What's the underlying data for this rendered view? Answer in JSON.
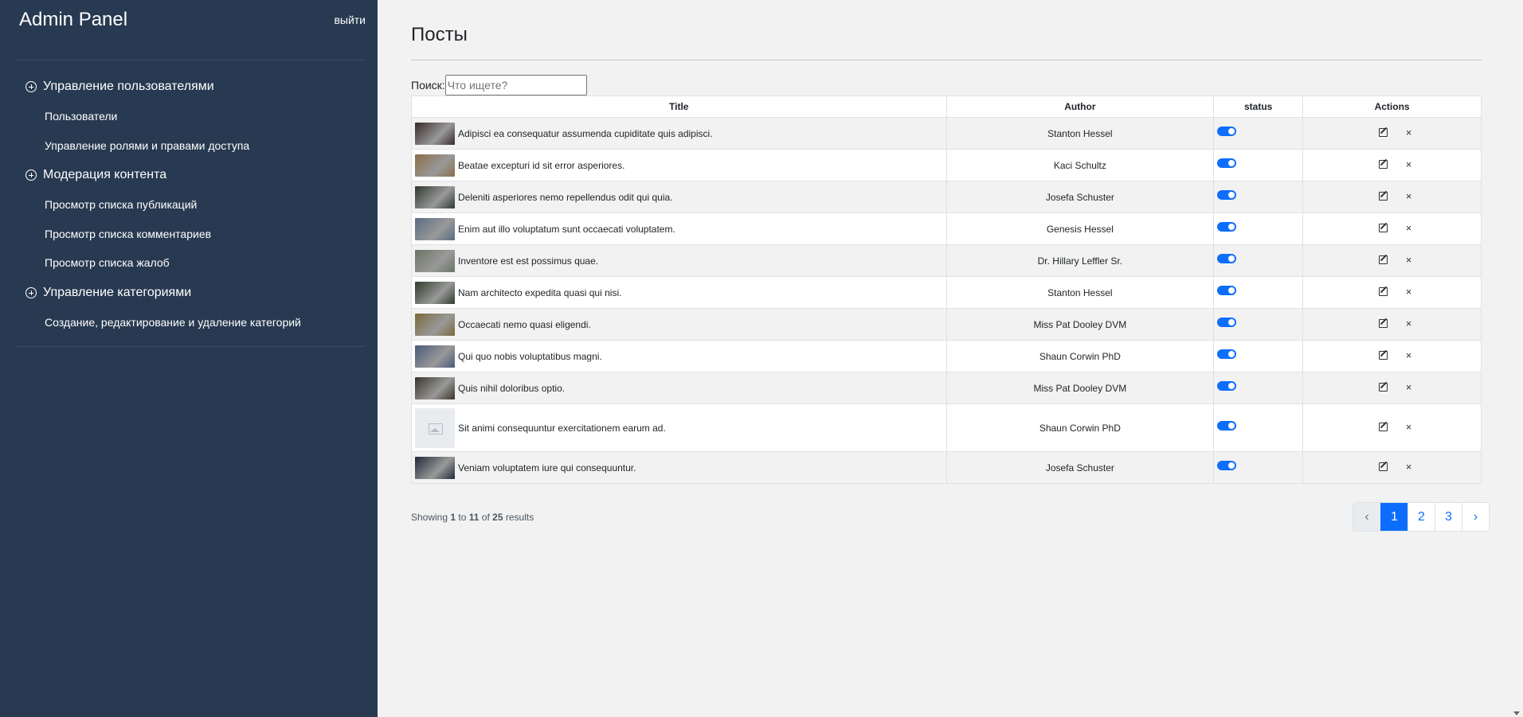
{
  "sidebar": {
    "title": "Admin Panel",
    "logout": "выйти",
    "groups": [
      {
        "label": "Управление пользователями",
        "items": [
          "Пользователи",
          "Управление ролями и правами доступа"
        ]
      },
      {
        "label": "Модерация контента",
        "items": [
          "Просмотр списка публикаций",
          "Просмотр списка комментариев",
          "Просмотр списка жалоб"
        ]
      },
      {
        "label": "Управление категориями",
        "items": [
          "Создание, редактирование и удаление категорий"
        ]
      }
    ]
  },
  "main": {
    "page_title": "Посты",
    "search": {
      "label": "Поиск:",
      "placeholder": "Что ищете?",
      "value": ""
    },
    "table": {
      "columns": [
        "Title",
        "Author",
        "status",
        "Actions"
      ],
      "rows": [
        {
          "title": "Adipisci ea consequatur assumenda cupiditate quis adipisci.",
          "author": "Stanton Hessel",
          "status_on": true,
          "thumb": "photo",
          "thumb_color": "#3a2a2a"
        },
        {
          "title": "Beatae excepturi id sit error asperiores.",
          "author": "Kaci Schultz",
          "status_on": true,
          "thumb": "photo",
          "thumb_color": "#8a6d4a"
        },
        {
          "title": "Deleniti asperiores nemo repellendus odit qui quia.",
          "author": "Josefa Schuster",
          "status_on": true,
          "thumb": "photo",
          "thumb_color": "#2f3a32"
        },
        {
          "title": "Enim aut illo voluptatum sunt occaecati voluptatem.",
          "author": "Genesis Hessel",
          "status_on": true,
          "thumb": "photo",
          "thumb_color": "#5a6b84"
        },
        {
          "title": "Inventore est est possimus quae.",
          "author": "Dr. Hillary Leffler Sr.",
          "status_on": true,
          "thumb": "photo",
          "thumb_color": "#6b7466"
        },
        {
          "title": "Nam architecto expedita quasi qui nisi.",
          "author": "Stanton Hessel",
          "status_on": true,
          "thumb": "photo",
          "thumb_color": "#2e3b2a"
        },
        {
          "title": "Occaecati nemo quasi eligendi.",
          "author": "Miss Pat Dooley DVM",
          "status_on": true,
          "thumb": "photo",
          "thumb_color": "#7a6a3a"
        },
        {
          "title": "Qui quo nobis voluptatibus magni.",
          "author": "Shaun Corwin PhD",
          "status_on": true,
          "thumb": "photo",
          "thumb_color": "#4a5a7a"
        },
        {
          "title": "Quis nihil doloribus optio.",
          "author": "Miss Pat Dooley DVM",
          "status_on": true,
          "thumb": "photo",
          "thumb_color": "#3b3428"
        },
        {
          "title": "Sit animi consequuntur exercitationem earum ad.",
          "author": "Shaun Corwin PhD",
          "status_on": true,
          "thumb": "placeholder",
          "thumb_color": "#e9ecef"
        },
        {
          "title": "Veniam voluptatem iure qui consequuntur.",
          "author": "Josefa Schuster",
          "status_on": true,
          "thumb": "photo",
          "thumb_color": "#1f2a3a"
        }
      ]
    },
    "results": {
      "prefix": "Showing",
      "from": "1",
      "to_word": "to",
      "to": "11",
      "of_word": "of",
      "total": "25",
      "suffix": "results"
    },
    "pagination": {
      "prev": "‹",
      "pages": [
        "1",
        "2",
        "3"
      ],
      "current": "1",
      "next": "›"
    }
  },
  "icons": {
    "group_toggle": "plus-circle-icon",
    "edit": "edit-icon",
    "delete": "close-icon",
    "thumb_placeholder": "image-icon"
  },
  "colors": {
    "sidebar_bg": "#283a51",
    "accent": "#0d6efd",
    "page_bg": "#f2f2f2"
  }
}
